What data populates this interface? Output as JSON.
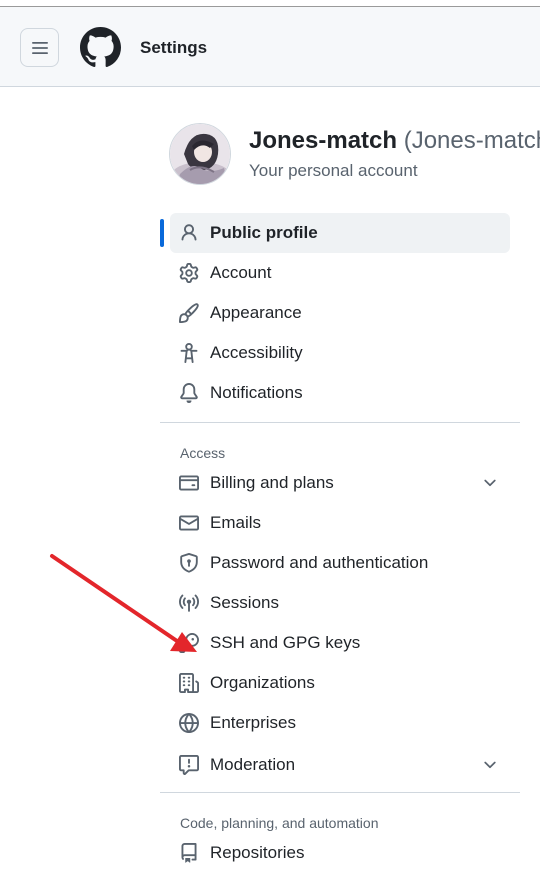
{
  "header": {
    "title": "Settings"
  },
  "profile": {
    "name": "Jones-match",
    "handle": "(Jones-match)",
    "subtitle": "Your personal account"
  },
  "nav": {
    "items": [
      {
        "label": "Public profile",
        "icon": "person-icon",
        "active": true
      },
      {
        "label": "Account",
        "icon": "gear-icon"
      },
      {
        "label": "Appearance",
        "icon": "paintbrush-icon"
      },
      {
        "label": "Accessibility",
        "icon": "accessibility-icon"
      },
      {
        "label": "Notifications",
        "icon": "bell-icon"
      }
    ],
    "access_title": "Access",
    "access_items": [
      {
        "label": "Billing and plans",
        "icon": "credit-card-icon",
        "expandable": true
      },
      {
        "label": "Emails",
        "icon": "mail-icon"
      },
      {
        "label": "Password and authentication",
        "icon": "shield-lock-icon"
      },
      {
        "label": "Sessions",
        "icon": "broadcast-icon"
      },
      {
        "label": "SSH and GPG keys",
        "icon": "key-icon"
      },
      {
        "label": "Organizations",
        "icon": "organization-icon"
      },
      {
        "label": "Enterprises",
        "icon": "globe-icon"
      },
      {
        "label": "Moderation",
        "icon": "report-icon",
        "expandable": true
      }
    ],
    "code_title": "Code, planning, and automation",
    "code_items": [
      {
        "label": "Repositories",
        "icon": "repo-icon"
      }
    ]
  },
  "annotation": {
    "arrow_color": "#e3262b"
  },
  "colors": {
    "accent": "#0969da",
    "header_bg": "#f6f8fa"
  }
}
